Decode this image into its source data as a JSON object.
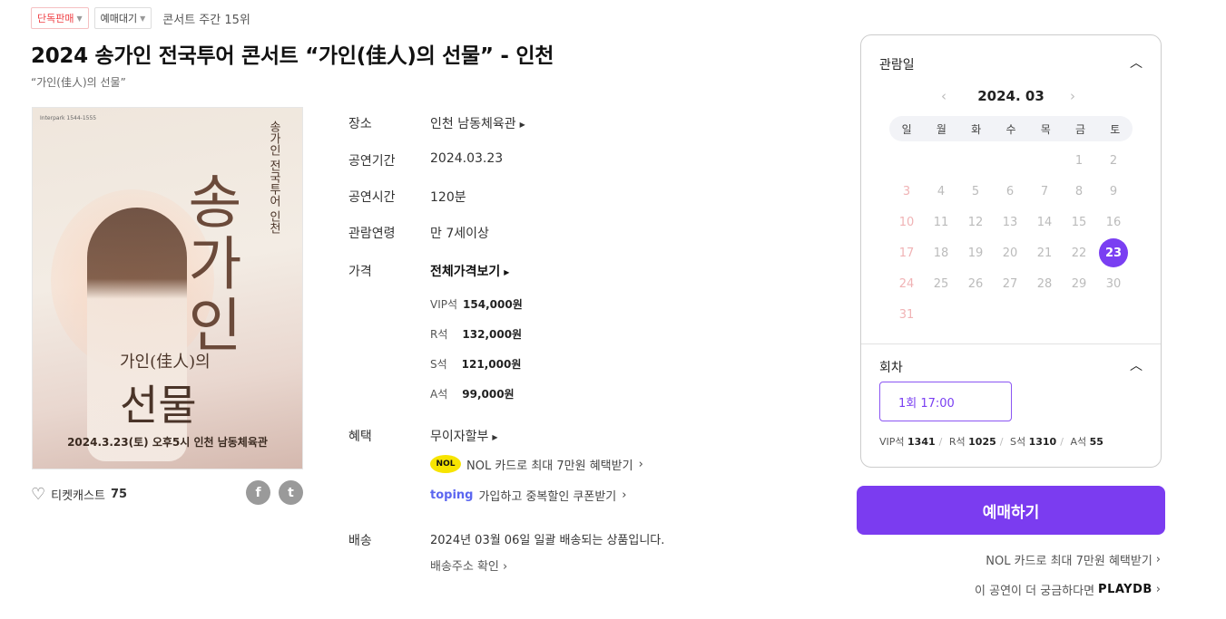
{
  "tags": {
    "exclusive": "단독판매",
    "waiting": "예매대기",
    "rank": "콘서트 주간 15위"
  },
  "title": "2024 송가인 전국투어 콘서트 “가인(佳人)의 선물” - 인천",
  "subtitle": "“가인(佳人)의 선물”",
  "poster": {
    "logo": "Interpark 1544-1555",
    "vertical_text": "송가인 전국투어 인천",
    "big_name": "송가인",
    "sub_title1": "가인(佳人)의",
    "sub_title2": "선물",
    "footer": "2024.3.23(토) 오후5시 인천 남동체육관"
  },
  "like": {
    "label": "티켓캐스트",
    "count": "75"
  },
  "share": {
    "facebook": "f",
    "twitter": "t"
  },
  "info": {
    "venue_label": "장소",
    "venue": "인천 남동체육관",
    "period_label": "공연기간",
    "period": "2024.03.23",
    "duration_label": "공연시간",
    "duration": "120분",
    "age_label": "관람연령",
    "age": "만 7세이상",
    "price_label": "가격",
    "price_all": "전체가격보기",
    "prices": [
      {
        "grade": "VIP석",
        "amount": "154,000원"
      },
      {
        "grade": "R석",
        "amount": "132,000원"
      },
      {
        "grade": "S석",
        "amount": "121,000원"
      },
      {
        "grade": "A석",
        "amount": "99,000원"
      }
    ],
    "benefit_label": "혜택",
    "benefit": "무이자할부",
    "nol_badge": "NOL",
    "nol_promo": "NOL 카드로 최대 7만원 혜택받기",
    "toping_logo": "toping",
    "toping_promo": "가입하고 중복할인 쿠폰받기",
    "delivery_label": "배송",
    "delivery": "2024년 03월 06일 일괄 배송되는 상품입니다.",
    "delivery_link": "배송주소 확인"
  },
  "calendar": {
    "heading": "관람일",
    "month": "2024. 03",
    "weekdays": [
      "일",
      "월",
      "화",
      "수",
      "목",
      "금",
      "토"
    ],
    "selected_day": "23",
    "session_heading": "회차",
    "session": "1회 17:00",
    "seats": [
      {
        "grade": "VIP석",
        "count": "1341"
      },
      {
        "grade": "R석",
        "count": "1025"
      },
      {
        "grade": "S석",
        "count": "1310"
      },
      {
        "grade": "A석",
        "count": "55"
      }
    ]
  },
  "book_button": "예매하기",
  "side_links": {
    "nol": "NOL 카드로 최대 7만원 혜택받기",
    "playdb_text": "이 공연이 더 궁금하다면",
    "playdb_logo": "PLAYDB"
  },
  "colors": {
    "accent": "#7b3cf0",
    "exclusive": "#ef3e43"
  }
}
